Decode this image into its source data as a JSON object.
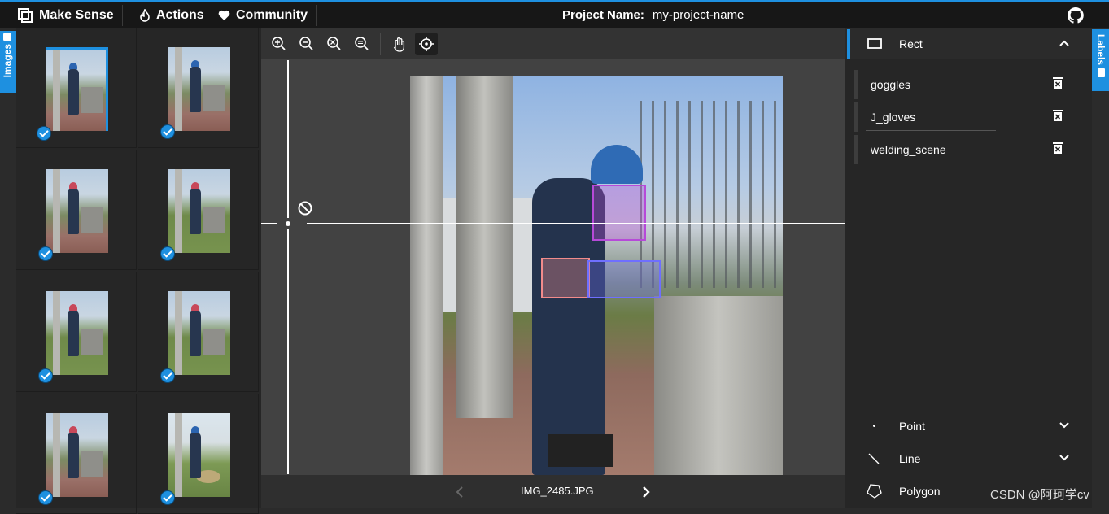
{
  "app": {
    "brand": "Make Sense",
    "menu": [
      {
        "label": "Actions"
      },
      {
        "label": "Community"
      }
    ],
    "project_label": "Project Name:",
    "project_name": "my-project-name"
  },
  "side_tabs": {
    "left": "Images",
    "right": "Labels"
  },
  "thumbnails": [
    {
      "name": "thumb-1",
      "checked": true,
      "selected": true
    },
    {
      "name": "thumb-2",
      "checked": true
    },
    {
      "name": "thumb-3",
      "checked": true
    },
    {
      "name": "thumb-4",
      "checked": true
    },
    {
      "name": "thumb-5",
      "checked": true
    },
    {
      "name": "thumb-6",
      "checked": true
    },
    {
      "name": "thumb-7",
      "checked": true
    },
    {
      "name": "thumb-8",
      "checked": true
    }
  ],
  "toolbar": {
    "icons": [
      "zoom-in-icon",
      "zoom-out-icon",
      "zoom-fit-icon",
      "zoom-actual-icon",
      "pan-hand-icon",
      "crosshair-icon"
    ],
    "active": "crosshair-icon"
  },
  "editor": {
    "filename": "IMG_2485.JPG",
    "annotations": [
      {
        "label": "goggles",
        "color": "#b64ad8"
      },
      {
        "label": "J_gloves",
        "color": "#f28b8b"
      },
      {
        "label": "welding_scene",
        "color": "#6f6fff"
      }
    ]
  },
  "labels_panel": {
    "rect_header": "Rect",
    "labels": [
      {
        "text": "goggles"
      },
      {
        "text": "J_gloves"
      },
      {
        "text": "welding_scene"
      }
    ],
    "tools": [
      {
        "label": "Point"
      },
      {
        "label": "Line"
      },
      {
        "label": "Polygon"
      }
    ]
  },
  "watermark": "CSDN @阿珂学cv"
}
